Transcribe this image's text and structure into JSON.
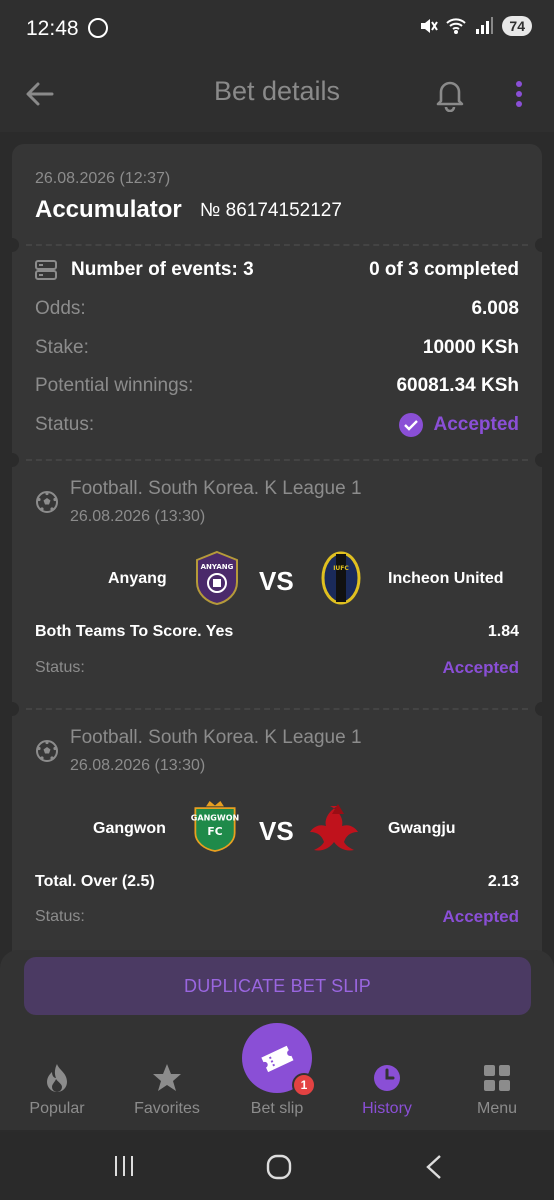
{
  "status_bar": {
    "time": "12:48",
    "battery": "74",
    "signal_label": "5"
  },
  "header": {
    "title": "Bet details"
  },
  "bet": {
    "datetime": "26.08.2026 (12:37)",
    "type": "Accumulator",
    "number": "№ 86174152127",
    "events_label": "Number of events: 3",
    "completed": "0 of 3 completed",
    "odds_label": "Odds:",
    "odds": "6.008",
    "stake_label": "Stake:",
    "stake": "10000 KSh",
    "winnings_label": "Potential winnings:",
    "winnings": "60081.34 KSh",
    "status_label": "Status:",
    "status": "Accepted"
  },
  "events": [
    {
      "league": "Football. South Korea. K League 1",
      "date": "26.08.2026 (13:30)",
      "home": "Anyang",
      "away": "Incheon United",
      "vs": "VS",
      "market": "Both Teams To Score. Yes",
      "odd": "1.84",
      "status_label": "Status:",
      "status": "Accepted",
      "home_logo_text": "ANYANG",
      "away_logo_text": "IUFC"
    },
    {
      "league": "Football. South Korea. K League 1",
      "date": "26.08.2026 (13:30)",
      "home": "Gangwon",
      "away": "Gwangju",
      "vs": "VS",
      "market": "Total. Over (2.5)",
      "odd": "2.13",
      "status_label": "Status:",
      "status": "Accepted",
      "home_logo_text": "GANGWON",
      "home_logo_sub": "FC"
    }
  ],
  "actions": {
    "duplicate": "DUPLICATE BET SLIP"
  },
  "nav": {
    "popular": "Popular",
    "favorites": "Favorites",
    "betslip": "Bet slip",
    "history": "History",
    "menu": "Menu",
    "badge": "1"
  },
  "colors": {
    "accent": "#8a4fd6",
    "background": "#2b2b2b",
    "card": "#363636",
    "badge": "#e34242"
  },
  "icons": [
    "whatsapp-icon",
    "mute-icon",
    "wifi-icon",
    "signal-icon",
    "battery-icon",
    "back-arrow-icon",
    "bell-icon",
    "kebab-menu-icon",
    "events-list-icon",
    "check-circle-icon",
    "football-icon",
    "fire-icon",
    "star-icon",
    "ticket-icon",
    "clock-icon",
    "grid-icon"
  ]
}
